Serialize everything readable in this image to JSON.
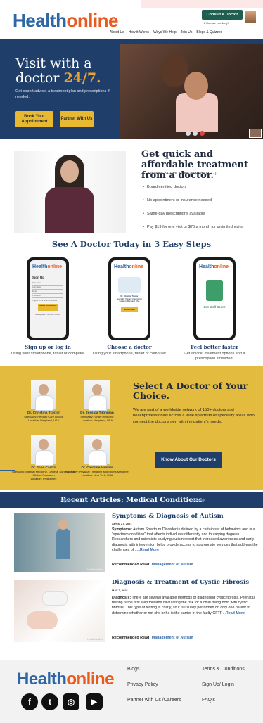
{
  "header": {
    "logo_a": "Health",
    "logo_b": "online",
    "consult_label": "Consult A Doctor",
    "help_text": "Hi! How are you doing?",
    "nav": [
      "About Us",
      "How it Works",
      "Ways We Help",
      "Join Us",
      "Blogs & Quizzes"
    ]
  },
  "hero": {
    "title_line1": "Visit with a",
    "title_line2": "doctor",
    "title_highlight": "24/7.",
    "subtitle": "Get expert advice, a treatment plan and prescriptions if needed.",
    "btn_book": "Book Your Appointment",
    "btn_partner": "Partner With Us"
  },
  "quick": {
    "title": "Get quick and affordable treatment from a doctor.",
    "items": [
      "Available 24/7 for adults and kids (3-17)",
      "Board-certified doctors",
      "No appointment or insurance needed",
      "Same-day prescriptions available",
      "Pay $19 for one visit or $75 a month for unlimited visits"
    ]
  },
  "steps": {
    "title": "See A Doctor Today in 3 Easy Steps",
    "list": [
      {
        "title": "Sign up or log in",
        "sub": "Using your smartphone, tablet or computer"
      },
      {
        "title": "Choose a doctor",
        "sub": "Using your smartphone, tablet or computer"
      },
      {
        "title": "Feel better faster",
        "sub": "Get advice, treatment options and a prescription if needed."
      }
    ],
    "phone1": {
      "heading": "Sign Up",
      "fields": [
        "First Name",
        "Last Name",
        "Email",
        "Password"
      ],
      "terms": "I agree to the terms & services",
      "button": "Create An Account",
      "footer": "Already have an account? LOGIN"
    },
    "phone2": {
      "doctor": "Dr. Christina Tractor",
      "spec": "Speciality: Primary Care Doctor",
      "loc": "Location: Maryland, USA",
      "button": "Book Now!"
    },
    "phone3": {
      "message": "Get Well Soon!"
    }
  },
  "doctors": {
    "title": "Select A Doctor of Your Choice.",
    "text": "We are part of a worldwide network of 150+ doctors and healthprofessionals across a wide spectrum of speciality areas who connect the doctor's pen with the patient's needs.",
    "button": "Know About Our Doctors",
    "cards": [
      {
        "name": "Dr. Christina Trastor",
        "spec": "Speciality: Primary Care Doctor",
        "loc": "Location: Maryland, USA"
      },
      {
        "name": "Dr. Jessica Tilghman",
        "spec": "Speciality:Family medicine",
        "loc": "Location: Maryland, USA"
      },
      {
        "name": "Dr. Jose Castro",
        "spec": "Speciality: Internal Medicine, General Surgery, and Clinical Research",
        "loc": "Location: Philippines"
      },
      {
        "name": "Dr. Caroline Vantals",
        "spec": "Speciality: Physical Therapist and Sports Medicine",
        "loc": "Location: New York, USA"
      }
    ]
  },
  "articles": {
    "title": "Recent Articles: Medical Conditions",
    "list": [
      {
        "title": "Symptoms & Diagnosis of Autism",
        "date": "APRIL 27, 2021",
        "lead": "Symptoms:",
        "body": " Autism Spectrum Disorder is defined by a certain set of behaviors and is a \"spectrum condition\" that affects individuals differently and to varying degrees. Researchers and scientists studying autism report that increased awareness and early diagnosis with intervention helps provide access to appropriate services that address the challenges of .....",
        "more": "Read More",
        "rec_label": "Recommended Read: ",
        "rec_link": "Management of Autism"
      },
      {
        "title": "Diagnosis & Treatment of Cystic Fibrosis",
        "date": "MAY 7, 2021",
        "lead": "Diagnosis:",
        "body": " There are several available methods of diagnosing cystic fibrosis. Prenatal testing is the first step towards calculating the risk for a child being born with cystic fibrosis. This type of testing is costly, so it is usually performed on only one parent to determine whether or not she or he is the carrier of the faulty CFTR...",
        "more": "Read More",
        "rec_label": "Recommended Read: ",
        "rec_link": "Management of Autism"
      }
    ],
    "watermark": "Healthonline"
  },
  "footer": {
    "col1": [
      "Blogs",
      "Privacy Policy",
      "Partner with Us /Careers"
    ],
    "col2": [
      "Terms & Conditions",
      "Sign Up/ Login",
      "FAQ's"
    ],
    "social": [
      {
        "icon": "facebook-icon",
        "glyph": "f"
      },
      {
        "icon": "twitter-icon",
        "glyph": "t"
      },
      {
        "icon": "instagram-icon",
        "glyph": "◎"
      },
      {
        "icon": "youtube-icon",
        "glyph": "▶"
      }
    ]
  },
  "colors": {
    "navy": "#1f3f6a",
    "orange": "#e85a1e",
    "blue": "#2f67a6",
    "gold": "#e3bb3f",
    "green": "#1e5f4f"
  }
}
